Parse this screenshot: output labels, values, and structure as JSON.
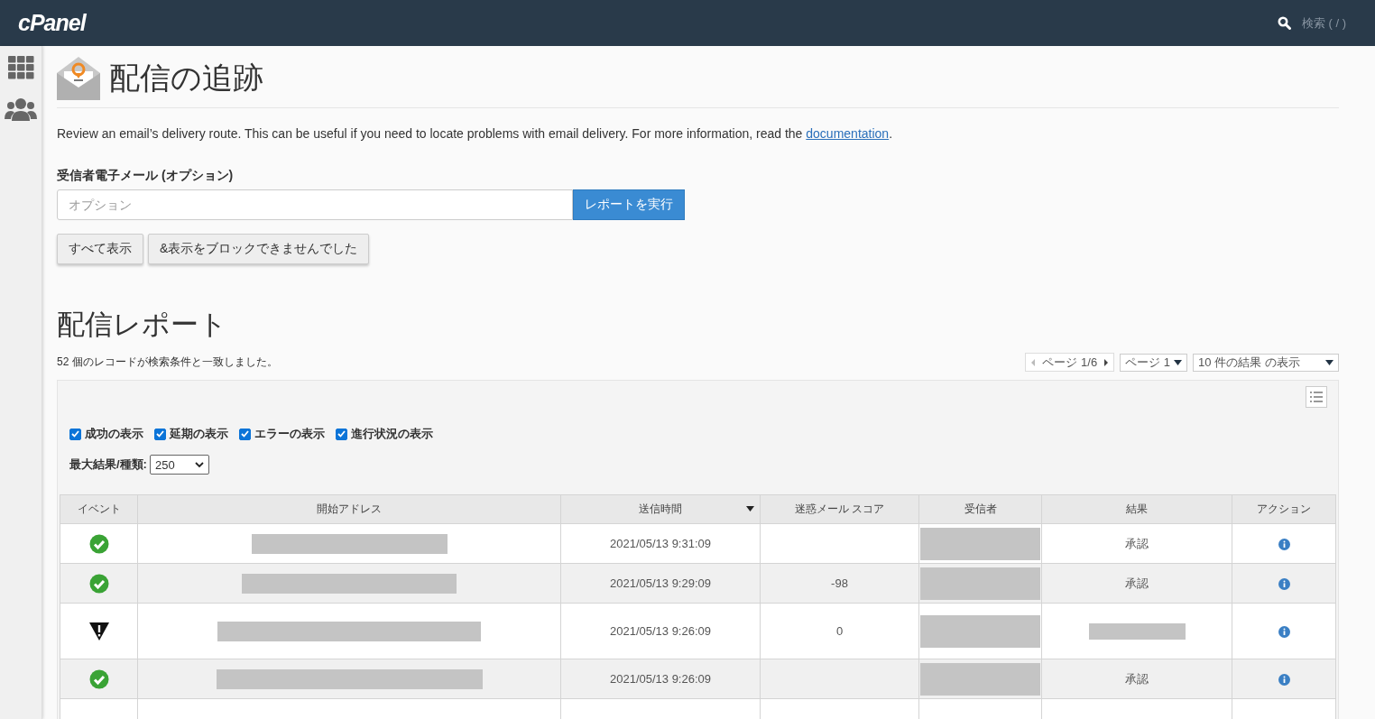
{
  "header": {
    "logo": "cPanel",
    "search_placeholder": "検索 ( / )"
  },
  "page": {
    "title": "配信の追跡",
    "description_before": "Review an email’s delivery route. This can be useful if you need to locate problems with email delivery. For more information, read the ",
    "description_link": "documentation",
    "description_after": "."
  },
  "form": {
    "label": "受信者電子メール (オプション)",
    "placeholder": "オプション",
    "run_button": "レポートを実行",
    "buttons": [
      "すべて表示",
      "&表示をブロックできませんでした"
    ]
  },
  "report": {
    "title": "配信レポート",
    "match_count": "52 個のレコードが検索条件と一致しました。",
    "pager": {
      "page_text": "ページ 1/6",
      "page_select": "ページ 1",
      "per_page": "10 件の結果 の表示"
    },
    "filters": [
      {
        "label": "成功の表示",
        "checked": true
      },
      {
        "label": "延期の表示",
        "checked": true
      },
      {
        "label": "エラーの表示",
        "checked": true
      },
      {
        "label": "進行状況の表示",
        "checked": true
      }
    ],
    "max_label": "最大結果/種類:",
    "max_value": "250"
  },
  "table": {
    "columns": [
      {
        "label": "イベント",
        "sorted": false
      },
      {
        "label": "開始アドレス",
        "sorted": false
      },
      {
        "label": "送信時間",
        "sorted": true
      },
      {
        "label": "迷惑メール スコア",
        "sorted": false
      },
      {
        "label": "受信者",
        "sorted": false
      },
      {
        "label": "結果",
        "sorted": false
      },
      {
        "label": "アクション",
        "sorted": false
      }
    ],
    "rows": [
      {
        "kind": "success",
        "time": "2021/05/13 9:31:09",
        "score": "",
        "result": "承認"
      },
      {
        "kind": "success",
        "time": "2021/05/13 9:29:09",
        "score": "-98",
        "result": "承認"
      },
      {
        "kind": "warning",
        "time": "2021/05/13 9:26:09",
        "score": "0",
        "result": ""
      },
      {
        "kind": "success",
        "time": "2021/05/13 9:26:09",
        "score": "",
        "result": "承認"
      }
    ]
  }
}
